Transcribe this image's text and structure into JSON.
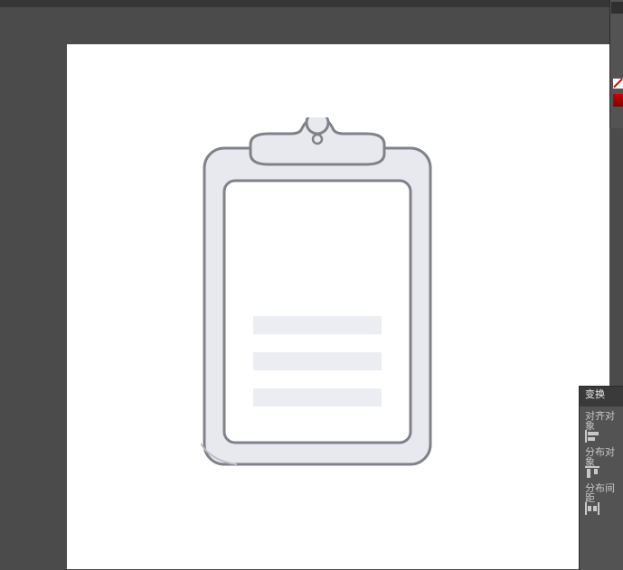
{
  "panel": {
    "tab": "变换",
    "section_align": "对齐对象",
    "section_distribute": "分布对象",
    "section_spacing": "分布间距"
  },
  "swatches": {
    "none": "none",
    "red": "#cc0000"
  },
  "artwork": {
    "type": "clipboard-illustration",
    "bg_board": "#e8e9ee",
    "stroke": "#808189",
    "paper": "#ffffff",
    "line_fill": "#ebedf2"
  }
}
